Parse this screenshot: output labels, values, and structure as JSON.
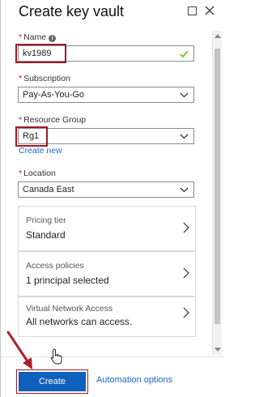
{
  "blade": {
    "title": "Create key vault"
  },
  "fields": {
    "name": {
      "label": "Name",
      "value": "kv1989"
    },
    "subscription": {
      "label": "Subscription",
      "value": "Pay-As-You-Go"
    },
    "resource_group": {
      "label": "Resource Group",
      "value": "Rg1",
      "create_new": "Create new"
    },
    "location": {
      "label": "Location",
      "value": "Canada East"
    }
  },
  "sections": {
    "pricing": {
      "label": "Pricing tier",
      "value": "Standard"
    },
    "access": {
      "label": "Access policies",
      "value": "1 principal selected"
    },
    "network": {
      "label": "Virtual Network Access",
      "value": "All networks can access."
    }
  },
  "footer": {
    "create_label": "Create",
    "automation_label": "Automation options"
  },
  "colors": {
    "primary": "#0f5fbd",
    "link": "#1f66c6",
    "required": "#c8102e",
    "highlight": "#9b1b28",
    "valid": "#6bb700"
  },
  "icons": [
    "maximize-icon",
    "close-icon",
    "info-icon",
    "checkmark-icon",
    "chevron-down-icon",
    "chevron-right-icon",
    "mouse-pointer-icon"
  ]
}
